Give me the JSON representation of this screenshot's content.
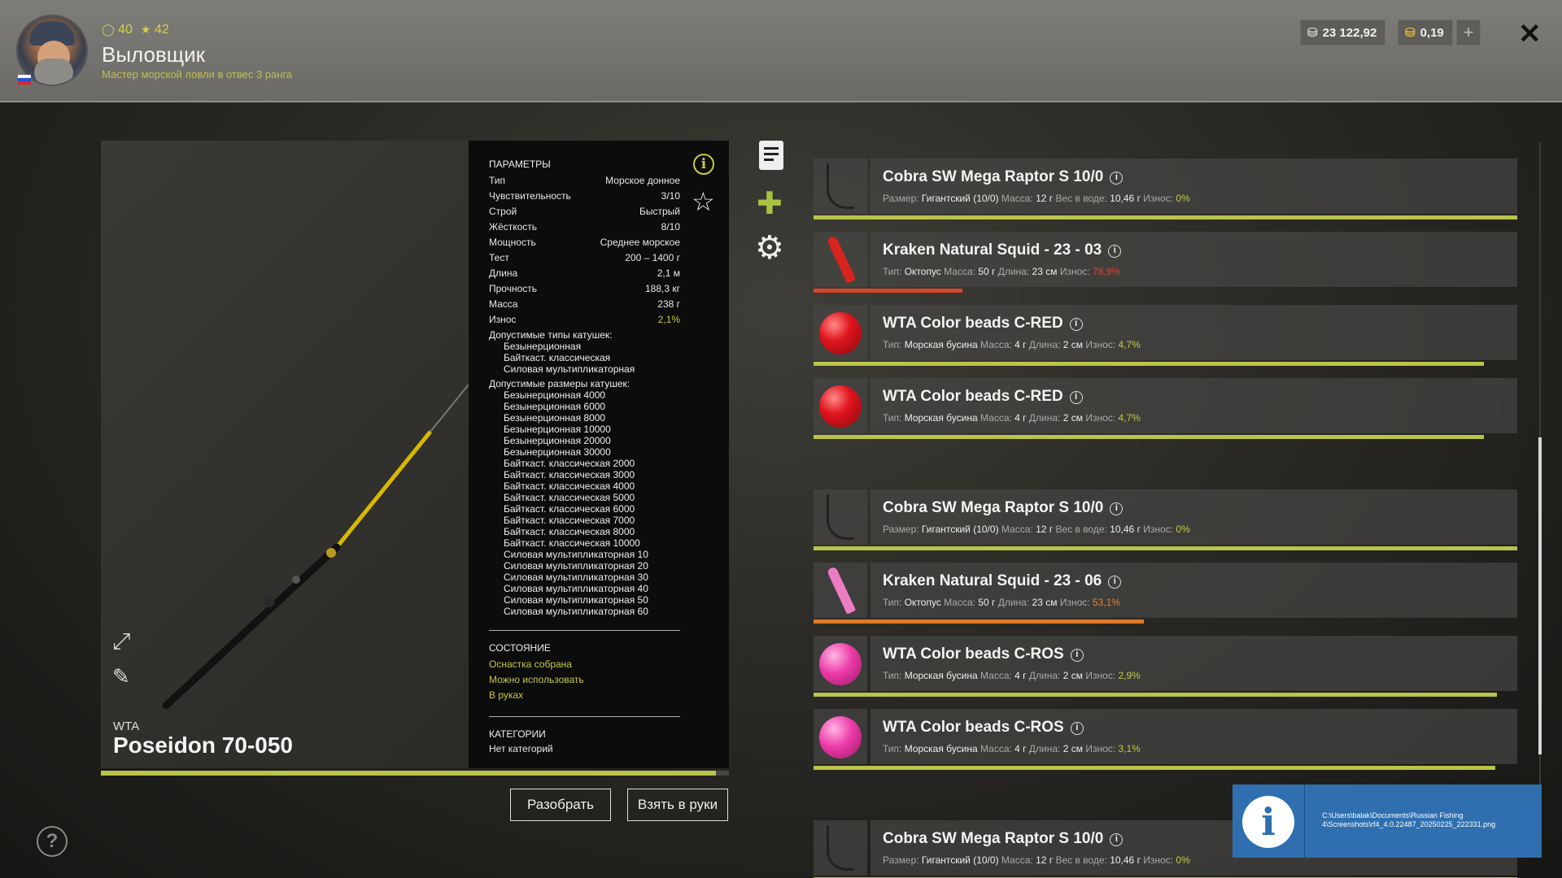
{
  "header": {
    "level": "40",
    "stars": "42",
    "player_name": "Выловщик",
    "rank": "Мастер морской ловли в отвес 3 ранга",
    "silver": "23 122,92",
    "gold": "0,19",
    "add": "+",
    "close": "✕"
  },
  "rod": {
    "brand": "WTA",
    "name": "Poseidon 70-050",
    "wear_fraction": 0.979
  },
  "params": {
    "title": "ПАРАМЕТРЫ",
    "rows": [
      {
        "k": "Тип",
        "v": "Морское донное"
      },
      {
        "k": "Чувствительность",
        "v": "3/10"
      },
      {
        "k": "Строй",
        "v": "Быстрый"
      },
      {
        "k": "Жёсткость",
        "v": "8/10"
      },
      {
        "k": "Мощность",
        "v": "Среднее морское"
      },
      {
        "k": "Тест",
        "v": "200 – 1400 г"
      },
      {
        "k": "Длина",
        "v": "2,1 м"
      },
      {
        "k": "Прочность",
        "v": "188,3 кг"
      },
      {
        "k": "Масса",
        "v": "238 г"
      },
      {
        "k": "Износ",
        "v": "2,1%"
      }
    ],
    "reel_types_title": "Допустимые типы катушек:",
    "reel_types": [
      "Безынерционная",
      "Байткаст. классическая",
      "Силовая мультипликаторная"
    ],
    "reel_sizes_title": "Допустимые размеры катушек:",
    "reel_sizes": [
      "Безынерционная 4000",
      "Безынерционная 6000",
      "Безынерционная 8000",
      "Безынерционная 10000",
      "Безынерционная 20000",
      "Безынерционная 30000",
      "Байткаст. классическая 2000",
      "Байткаст. классическая 3000",
      "Байткаст. классическая 4000",
      "Байткаст. классическая 5000",
      "Байткаст. классическая 6000",
      "Байткаст. классическая 7000",
      "Байткаст. классическая 8000",
      "Байткаст. классическая 10000",
      "Силовая мультипликаторная 10",
      "Силовая мультипликаторная 20",
      "Силовая мультипликаторная 30",
      "Силовая мультипликаторная 40",
      "Силовая мультипликаторная 50",
      "Силовая мультипликаторная 60"
    ],
    "state_title": "СОСТОЯНИЕ",
    "state_items": [
      "Оснастка собрана",
      "Можно использовать",
      "В руках"
    ],
    "categories_title": "КАТЕГОРИИ",
    "categories_value": "Нет категорий"
  },
  "buttons": {
    "dismantle": "Разобрать",
    "take": "Взять в руки"
  },
  "tackle": [
    {
      "name": "Cobra SW Mega Raptor S 10/0",
      "kind": "hook",
      "meta": [
        [
          "Размер:",
          "Гигантский (10/0)"
        ],
        [
          "Масса:",
          "12 г"
        ],
        [
          "Вес в воде:",
          "10,46 г"
        ],
        [
          "Износ:",
          ""
        ]
      ],
      "wear": "0%",
      "wear_color": "#c8c84a",
      "fill": 1.0,
      "bar_color": "#bac34a"
    },
    {
      "name": "Kraken Natural Squid - 23 - 03",
      "kind": "squid-red",
      "meta": [
        [
          "Тип:",
          "Октопус"
        ],
        [
          "Масса:",
          "50 г"
        ],
        [
          "Длина:",
          "23 см"
        ],
        [
          "Износ:",
          ""
        ]
      ],
      "wear": "78,9%",
      "wear_color": "#e0402c",
      "fill": 0.211,
      "bar_color": "#d8442a"
    },
    {
      "name": "WTA Color beads C-RED",
      "kind": "bead-red",
      "meta": [
        [
          "Тип:",
          "Морская бусина"
        ],
        [
          "Масса:",
          "4 г"
        ],
        [
          "Длина:",
          "2 см"
        ],
        [
          "Износ:",
          ""
        ]
      ],
      "wear": "4,7%",
      "wear_color": "#c8c84a",
      "fill": 0.953,
      "bar_color": "#bac34a"
    },
    {
      "name": "WTA Color beads C-RED",
      "kind": "bead-red",
      "meta": [
        [
          "Тип:",
          "Морская бусина"
        ],
        [
          "Масса:",
          "4 г"
        ],
        [
          "Длина:",
          "2 см"
        ],
        [
          "Износ:",
          ""
        ]
      ],
      "wear": "4,7%",
      "wear_color": "#c8c84a",
      "fill": 0.953,
      "bar_color": "#bac34a"
    },
    {
      "name": "Cobra SW Mega Raptor S 10/0",
      "kind": "hook",
      "meta": [
        [
          "Размер:",
          "Гигантский (10/0)"
        ],
        [
          "Масса:",
          "12 г"
        ],
        [
          "Вес в воде:",
          "10,46 г"
        ],
        [
          "Износ:",
          ""
        ]
      ],
      "wear": "0%",
      "wear_color": "#c8c84a",
      "fill": 1.0,
      "bar_color": "#bac34a"
    },
    {
      "name": "Kraken Natural Squid - 23 - 06",
      "kind": "squid-pink",
      "meta": [
        [
          "Тип:",
          "Октопус"
        ],
        [
          "Масса:",
          "50 г"
        ],
        [
          "Длина:",
          "23 см"
        ],
        [
          "Износ:",
          ""
        ]
      ],
      "wear": "53,1%",
      "wear_color": "#e8832a",
      "fill": 0.469,
      "bar_color": "#e07a28"
    },
    {
      "name": "WTA Color beads C-ROS",
      "kind": "bead-pink",
      "meta": [
        [
          "Тип:",
          "Морская бусина"
        ],
        [
          "Масса:",
          "4 г"
        ],
        [
          "Длина:",
          "2 см"
        ],
        [
          "Износ:",
          ""
        ]
      ],
      "wear": "2,9%",
      "wear_color": "#c8c84a",
      "fill": 0.971,
      "bar_color": "#bac34a"
    },
    {
      "name": "WTA Color beads C-ROS",
      "kind": "bead-pink",
      "meta": [
        [
          "Тип:",
          "Морская бусина"
        ],
        [
          "Масса:",
          "4 г"
        ],
        [
          "Длина:",
          "2 см"
        ],
        [
          "Износ:",
          ""
        ]
      ],
      "wear": "3,1%",
      "wear_color": "#c8c84a",
      "fill": 0.969,
      "bar_color": "#bac34a"
    },
    {
      "name": "Cobra SW Mega Raptor S 10/0",
      "kind": "hook",
      "meta": [
        [
          "Размер:",
          "Гигантский (10/0)"
        ],
        [
          "Масса:",
          "12 г"
        ],
        [
          "Вес в воде:",
          "10,46 г"
        ],
        [
          "Износ:",
          ""
        ]
      ],
      "wear": "0%",
      "wear_color": "#c8c84a",
      "fill": 1.0,
      "bar_color": "#bac34a"
    }
  ],
  "toast": {
    "icon": "i",
    "text": "C:\\Users\\balak\\Documents\\Russian Fishing 4\\Screenshots\\rf4_4.0.22487_20250225_222331.png"
  },
  "help": "?",
  "icons": {
    "level": "level-circle-icon",
    "star": "star-icon",
    "silver": "silver-coins-icon",
    "gold": "gold-coins-icon",
    "info": "info-icon",
    "favorite": "favorite-star-icon",
    "document": "document-icon",
    "puzzle": "puzzle-icon",
    "gear": "gear-icon",
    "expand": "expand-icon",
    "edit": "edit-icon",
    "help": "help-icon"
  }
}
